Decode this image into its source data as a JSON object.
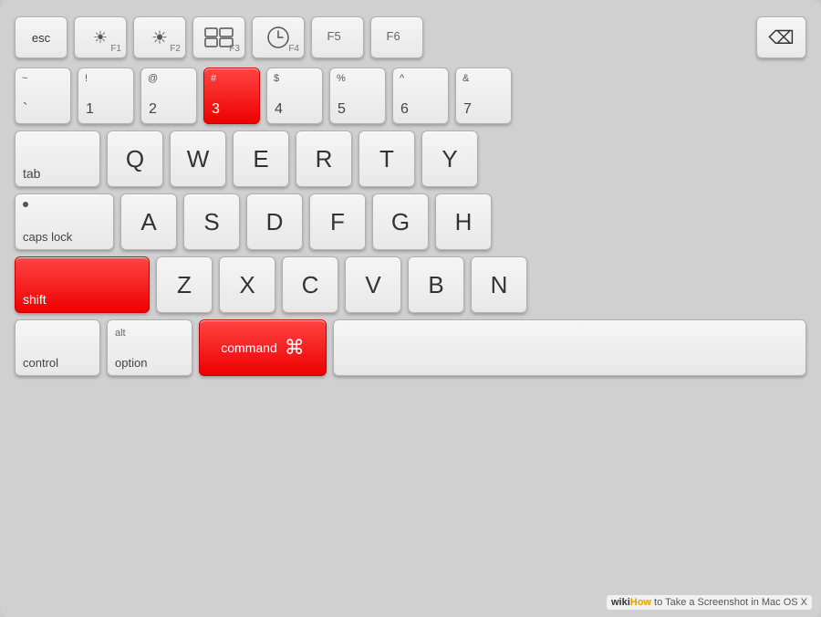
{
  "keyboard": {
    "rows": {
      "fn_row": {
        "keys": [
          {
            "id": "esc",
            "label": "esc",
            "size": "esc"
          },
          {
            "id": "f1",
            "label": "F1",
            "icon": "sun-dim",
            "size": "fn"
          },
          {
            "id": "f2",
            "label": "F2",
            "icon": "sun-bright",
            "size": "fn"
          },
          {
            "id": "f3",
            "label": "F3",
            "icon": "mission-ctrl",
            "size": "fn"
          },
          {
            "id": "f4",
            "label": "F4",
            "icon": "dashboard",
            "size": "fn"
          },
          {
            "id": "f5",
            "label": "F5",
            "size": "fn"
          },
          {
            "id": "f6",
            "label": "F6",
            "size": "fn"
          },
          {
            "id": "backspace",
            "label": "←",
            "size": "backspace"
          }
        ]
      },
      "number_row": {
        "keys": [
          {
            "id": "tilde",
            "top": "~",
            "bottom": "`",
            "size": "std"
          },
          {
            "id": "1",
            "top": "!",
            "bottom": "1",
            "size": "std"
          },
          {
            "id": "2",
            "top": "@",
            "bottom": "2",
            "size": "std"
          },
          {
            "id": "3",
            "top": "#",
            "bottom": "3",
            "size": "std",
            "highlight": true
          },
          {
            "id": "4",
            "top": "$",
            "bottom": "4",
            "size": "std"
          },
          {
            "id": "5",
            "top": "%",
            "bottom": "5",
            "size": "std"
          },
          {
            "id": "6",
            "top": "^",
            "bottom": "6",
            "size": "std"
          },
          {
            "id": "7",
            "top": "&",
            "bottom": "7",
            "size": "std"
          }
        ]
      },
      "qwerty_row": {
        "keys": [
          {
            "id": "tab",
            "label": "tab",
            "size": "tab"
          },
          {
            "id": "q",
            "label": "Q",
            "size": "std"
          },
          {
            "id": "w",
            "label": "W",
            "size": "std"
          },
          {
            "id": "e",
            "label": "E",
            "size": "std"
          },
          {
            "id": "r",
            "label": "R",
            "size": "std"
          },
          {
            "id": "t",
            "label": "T",
            "size": "std"
          },
          {
            "id": "y",
            "label": "Y",
            "size": "std"
          }
        ]
      },
      "asdf_row": {
        "keys": [
          {
            "id": "capslock",
            "label": "caps lock",
            "size": "capslock",
            "dot": true
          },
          {
            "id": "a",
            "label": "A",
            "size": "std"
          },
          {
            "id": "s",
            "label": "S",
            "size": "std"
          },
          {
            "id": "d",
            "label": "D",
            "size": "std"
          },
          {
            "id": "f",
            "label": "F",
            "size": "std"
          },
          {
            "id": "g",
            "label": "G",
            "size": "std"
          },
          {
            "id": "h",
            "label": "H",
            "size": "std"
          }
        ]
      },
      "zxcv_row": {
        "keys": [
          {
            "id": "shift-l",
            "label": "shift",
            "size": "shift-l",
            "highlight": true
          },
          {
            "id": "z",
            "label": "Z",
            "size": "std"
          },
          {
            "id": "x",
            "label": "X",
            "size": "std"
          },
          {
            "id": "c",
            "label": "C",
            "size": "std"
          },
          {
            "id": "v",
            "label": "V",
            "size": "std"
          },
          {
            "id": "b",
            "label": "B",
            "size": "std"
          },
          {
            "id": "n",
            "label": "N",
            "size": "std"
          }
        ]
      },
      "bottom_row": {
        "keys": [
          {
            "id": "control",
            "label": "control",
            "size": "control"
          },
          {
            "id": "option",
            "top": "alt",
            "bottom": "option",
            "size": "option"
          },
          {
            "id": "command",
            "label": "command",
            "symbol": "⌘",
            "size": "command",
            "highlight": true
          }
        ]
      }
    }
  },
  "badge": {
    "wiki": "wiki",
    "how": "How",
    "text": " to Take a Screenshot in Mac OS X"
  }
}
